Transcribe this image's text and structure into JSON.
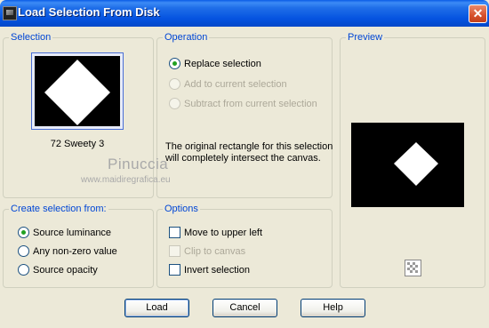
{
  "window": {
    "title": "Load Selection From Disk",
    "close_glyph": "✕"
  },
  "selection": {
    "group_title": "Selection",
    "file_name": "72 Sweety 3"
  },
  "operation": {
    "group_title": "Operation",
    "options": [
      {
        "label": "Replace selection",
        "checked": true,
        "enabled": true
      },
      {
        "label": "Add to current selection",
        "checked": false,
        "enabled": false
      },
      {
        "label": "Subtract from current selection",
        "checked": false,
        "enabled": false
      }
    ],
    "note": "The original rectangle for this selection will completely intersect the canvas."
  },
  "preview": {
    "group_title": "Preview",
    "transparency_icon": "checkerboard-icon"
  },
  "create_from": {
    "group_title": "Create selection from:",
    "options": [
      {
        "label": "Source luminance",
        "checked": true
      },
      {
        "label": "Any non-zero value",
        "checked": false
      },
      {
        "label": "Source opacity",
        "checked": false
      }
    ]
  },
  "options": {
    "group_title": "Options",
    "items": [
      {
        "label": "Move to upper left",
        "checked": false,
        "enabled": true
      },
      {
        "label": "Clip to canvas",
        "checked": false,
        "enabled": false
      },
      {
        "label": "Invert selection",
        "checked": false,
        "enabled": true
      }
    ]
  },
  "watermark": {
    "name": "Pinuccia",
    "url": "www.maidiregrafica.eu"
  },
  "buttons": {
    "load": "Load",
    "cancel": "Cancel",
    "help": "Help"
  },
  "colors": {
    "title_bar": "#0553e0",
    "group_title": "#0046d5",
    "dialog_bg": "#ECE9D8",
    "close": "#d6502c"
  }
}
